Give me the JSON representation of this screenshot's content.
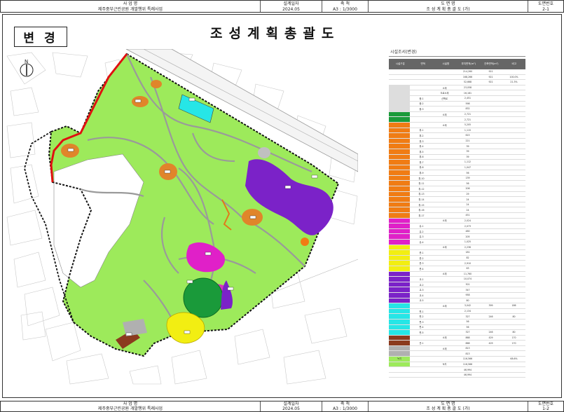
{
  "titleblock_top": {
    "project_label": "사 업 명",
    "project_name": "제주중부근린공원 개발행위 특례사업",
    "date_label": "설계일자",
    "date_value": "2024.05",
    "scale_label": "축 척",
    "scale_value": "A3 : 1/3000",
    "drawing_label": "도 면 명",
    "drawing_name": "조 성 계 획 총 괄 도 (가)",
    "number_label": "도면번호",
    "number_value": "2-1"
  },
  "titleblock_bottom": {
    "project_label": "사 업 명",
    "project_name": "제주중부근린공원 개발행위 특례사업",
    "date_label": "설계일자",
    "date_value": "2024.05",
    "scale_label": "축 척",
    "scale_value": "A3 : 1/3000",
    "drawing_label": "도 면 명",
    "drawing_name": "조 성 계 획 총 괄 도 (가)",
    "number_label": "도면번호",
    "number_value": "1-2"
  },
  "badge": "변 경",
  "main_title": "조성계획총괄도",
  "legend": {
    "title": "시설조서(변경)",
    "headers": [
      "시설구분",
      "면적",
      "시설명",
      "부지면적(m²)",
      "건축면적(m²)",
      "비고"
    ],
    "rows": [
      {
        "color": "#ffffff",
        "text": [
          "",
          "",
          "",
          "214,260",
          "921",
          ""
        ]
      },
      {
        "color": "#ffffff",
        "text": [
          "",
          "",
          "",
          "168,266",
          "921",
          "100.0%"
        ]
      },
      {
        "color": "#ffffff",
        "text": [
          "",
          "",
          "",
          "52,668",
          "921",
          "21.3%"
        ]
      },
      {
        "color": "#dddddd",
        "text": [
          "",
          "",
          "소계",
          "23,058",
          "",
          ""
        ]
      },
      {
        "color": "#dddddd",
        "text": [
          "",
          "",
          "도로소계",
          "16,181",
          "",
          ""
        ]
      },
      {
        "color": "#dddddd",
        "text": [
          "",
          "중-1",
          "산책로",
          "2,451",
          "",
          ""
        ]
      },
      {
        "color": "#dddddd",
        "text": [
          "",
          "중-2",
          "",
          "598",
          "",
          ""
        ]
      },
      {
        "color": "#dddddd",
        "text": [
          "",
          "중-3",
          "",
          "832",
          "",
          ""
        ]
      },
      {
        "color": "#1a9a3a",
        "text": [
          "",
          "",
          "소계",
          "2,721",
          "",
          ""
        ]
      },
      {
        "color": "#1a9a3a",
        "text": [
          "",
          "",
          "",
          "2,721",
          "",
          ""
        ]
      },
      {
        "color": "#f07c14",
        "text": [
          "",
          "",
          "소계",
          "5,205",
          "",
          ""
        ]
      },
      {
        "color": "#f07c14",
        "text": [
          "",
          "휴-1",
          "",
          "1,115",
          "",
          ""
        ]
      },
      {
        "color": "#f07c14",
        "text": [
          "",
          "휴-2",
          "",
          "615",
          "",
          ""
        ]
      },
      {
        "color": "#f07c14",
        "text": [
          "",
          "휴-3",
          "",
          "221",
          "",
          ""
        ]
      },
      {
        "color": "#f07c14",
        "text": [
          "",
          "휴-4",
          "",
          "39",
          "",
          ""
        ]
      },
      {
        "color": "#f07c14",
        "text": [
          "",
          "휴-5",
          "",
          "39",
          "",
          ""
        ]
      },
      {
        "color": "#f07c14",
        "text": [
          "",
          "휴-6",
          "",
          "39",
          "",
          ""
        ]
      },
      {
        "color": "#f07c14",
        "text": [
          "",
          "휴-7",
          "",
          "1,112",
          "",
          ""
        ]
      },
      {
        "color": "#f07c14",
        "text": [
          "",
          "휴-8",
          "",
          "1,047",
          "",
          ""
        ]
      },
      {
        "color": "#f07c14",
        "text": [
          "",
          "휴-9",
          "",
          "56",
          "",
          ""
        ]
      },
      {
        "color": "#f07c14",
        "text": [
          "",
          "휴-10",
          "",
          "139",
          "",
          ""
        ]
      },
      {
        "color": "#f07c14",
        "text": [
          "",
          "휴-11",
          "",
          "56",
          "",
          ""
        ]
      },
      {
        "color": "#f07c14",
        "text": [
          "",
          "휴-12",
          "",
          "206",
          "",
          ""
        ]
      },
      {
        "color": "#f07c14",
        "text": [
          "",
          "휴-13",
          "",
          "29",
          "",
          ""
        ]
      },
      {
        "color": "#f07c14",
        "text": [
          "",
          "휴-14",
          "",
          "24",
          "",
          ""
        ]
      },
      {
        "color": "#f07c14",
        "text": [
          "",
          "휴-15",
          "",
          "24",
          "",
          ""
        ]
      },
      {
        "color": "#f07c14",
        "text": [
          "",
          "휴-16",
          "",
          "24",
          "",
          ""
        ]
      },
      {
        "color": "#f07c14",
        "text": [
          "",
          "휴-17",
          "",
          "451",
          "",
          ""
        ]
      },
      {
        "color": "#e020c8",
        "text": [
          "",
          "",
          "소계",
          "2,024",
          "",
          ""
        ]
      },
      {
        "color": "#e020c8",
        "text": [
          "",
          "유-1",
          "",
          "2,073",
          "",
          ""
        ]
      },
      {
        "color": "#e020c8",
        "text": [
          "",
          "유-2",
          "",
          "480",
          "",
          ""
        ]
      },
      {
        "color": "#e020c8",
        "text": [
          "",
          "유-3",
          "",
          "205",
          "",
          ""
        ]
      },
      {
        "color": "#e020c8",
        "text": [
          "",
          "유-4",
          "",
          "1,025",
          "",
          ""
        ]
      },
      {
        "color": "#f2ee12",
        "text": [
          "",
          "",
          "소계",
          "2,236",
          "",
          ""
        ]
      },
      {
        "color": "#f2ee12",
        "text": [
          "",
          "운-1",
          "",
          "181",
          "",
          ""
        ]
      },
      {
        "color": "#f2ee12",
        "text": [
          "",
          "운-2",
          "",
          "82",
          "",
          ""
        ]
      },
      {
        "color": "#f2ee12",
        "text": [
          "",
          "운-3",
          "",
          "2,910",
          "",
          ""
        ]
      },
      {
        "color": "#f2ee12",
        "text": [
          "",
          "운-4",
          "",
          "63",
          "",
          ""
        ]
      },
      {
        "color": "#7b22c8",
        "text": [
          "",
          "",
          "소계",
          "11,760",
          "",
          ""
        ]
      },
      {
        "color": "#7b22c8",
        "text": [
          "",
          "교-1",
          "",
          "10,074",
          "",
          ""
        ]
      },
      {
        "color": "#7b22c8",
        "text": [
          "",
          "교-2",
          "",
          "301",
          "",
          ""
        ]
      },
      {
        "color": "#7b22c8",
        "text": [
          "",
          "교-3",
          "",
          "347",
          "",
          ""
        ]
      },
      {
        "color": "#7b22c8",
        "text": [
          "",
          "교-4",
          "",
          "958",
          "",
          ""
        ]
      },
      {
        "color": "#7b22c8",
        "text": [
          "",
          "교-5",
          "",
          "80",
          "",
          ""
        ]
      },
      {
        "color": "#26e6e6",
        "text": [
          "",
          "",
          "소계",
          "3,042",
          "399",
          "186"
        ]
      },
      {
        "color": "#26e6e6",
        "text": [
          "",
          "편-1",
          "",
          "2,134",
          "",
          ""
        ]
      },
      {
        "color": "#26e6e6",
        "text": [
          "",
          "편-2",
          "",
          "327",
          "246",
          "80"
        ]
      },
      {
        "color": "#26e6e6",
        "text": [
          "",
          "편-3",
          "",
          "56",
          "",
          ""
        ]
      },
      {
        "color": "#26e6e6",
        "text": [
          "",
          "편-4",
          "",
          "56",
          "",
          ""
        ]
      },
      {
        "color": "#26e6e6",
        "text": [
          "",
          "편-5",
          "",
          "327",
          "246",
          "80"
        ]
      },
      {
        "color": "#8b3a1e",
        "text": [
          "",
          "",
          "소계",
          "868",
          "429",
          "170"
        ]
      },
      {
        "color": "#8b3a1e",
        "text": [
          "",
          "관-1",
          "",
          "868",
          "429",
          "170"
        ]
      },
      {
        "color": "#b0b0b0",
        "text": [
          "",
          "",
          "소계",
          "813",
          "",
          ""
        ]
      },
      {
        "color": "#b0b0b0",
        "text": [
          "",
          "",
          "",
          "813",
          "",
          ""
        ]
      },
      {
        "color": "#9dea5b",
        "text": [
          "녹지",
          "",
          "",
          "116,566",
          "",
          "68.6%"
        ]
      },
      {
        "color": "#9dea5b",
        "text": [
          "",
          "",
          "녹지",
          "116,566",
          "",
          ""
        ]
      },
      {
        "color": "#ffffff",
        "text": [
          "",
          "",
          "",
          "46,994",
          "",
          ""
        ]
      },
      {
        "color": "#ffffff",
        "text": [
          "",
          "",
          "",
          "46,994",
          "",
          ""
        ]
      }
    ]
  },
  "map": {
    "colors": {
      "green": "#9dea5b",
      "orange": "#e0852a",
      "purple": "#7b22c8",
      "magenta": "#e020c8",
      "yellow": "#f2ee12",
      "cyan": "#26e6e6",
      "darkgreen": "#1a9a3a",
      "brown": "#8b3a1e",
      "redline": "#e01010"
    },
    "north_symbol": "N"
  }
}
